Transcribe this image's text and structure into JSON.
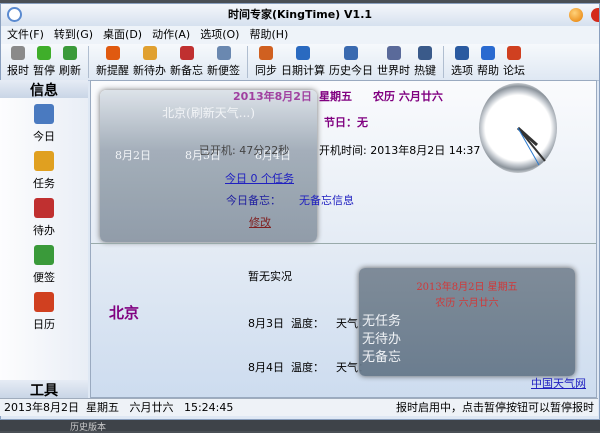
{
  "window": {
    "title": "时间专家(KingTime) V1.1"
  },
  "menu": [
    "文件(F)",
    "转到(G)",
    "桌面(D)",
    "动作(A)",
    "选项(O)",
    "帮助(H)"
  ],
  "toolbar": [
    {
      "label": "报时",
      "icon": "speaker-icon",
      "color": "#8a8a8a"
    },
    {
      "label": "暂停",
      "icon": "pause-icon",
      "color": "#3fae2a"
    },
    {
      "label": "刷新",
      "icon": "refresh-icon",
      "color": "#3a9a3a"
    },
    {
      "label": "新提醒",
      "icon": "alarm-clock-icon",
      "color": "#e05a10"
    },
    {
      "label": "新待办",
      "icon": "todo-icon",
      "color": "#e0a030"
    },
    {
      "label": "新备忘",
      "icon": "memo-grid-icon",
      "color": "#c03030"
    },
    {
      "label": "新便签",
      "icon": "note-icon",
      "color": "#6a88b0"
    },
    {
      "label": "同步",
      "icon": "sync-icon",
      "color": "#d06020"
    },
    {
      "label": "日期计算",
      "icon": "calculator-icon",
      "color": "#2a6ac0"
    },
    {
      "label": "历史今日",
      "icon": "history-icon",
      "color": "#3a6ab0"
    },
    {
      "label": "世界时",
      "icon": "globe-icon",
      "color": "#5a6a9a"
    },
    {
      "label": "热键",
      "icon": "joystick-icon",
      "color": "#3a5a8a"
    },
    {
      "label": "选项",
      "icon": "options-icon",
      "color": "#2a5aa0"
    },
    {
      "label": "帮助",
      "icon": "help-icon",
      "color": "#2a6ad0"
    },
    {
      "label": "论坛",
      "icon": "forum-icon",
      "color": "#d04020"
    }
  ],
  "sidebar": {
    "header": "信息",
    "items": [
      {
        "label": "今日",
        "icon": "today-icon",
        "color": "#4a7ac0"
      },
      {
        "label": "任务",
        "icon": "task-icon",
        "color": "#e0a020"
      },
      {
        "label": "待办",
        "icon": "todo-icon",
        "color": "#c03030"
      },
      {
        "label": "便签",
        "icon": "note-icon",
        "color": "#3a9a3a"
      },
      {
        "label": "日历",
        "icon": "calendar-icon",
        "color": "#d04020"
      }
    ],
    "footer": "工具"
  },
  "today": {
    "date": "2013年8月2日",
    "weekday": "星期五",
    "lunar": "农历 六月廿六",
    "festival": "节日：无",
    "uptime": "已开机: 47分22秒",
    "boot_time": "开机时间: 2013年8月2日 14:37",
    "tasks_link": "今日 0 个任务",
    "memo_label": "今日备忘：",
    "memo_value": "无备忘信息",
    "edit_link": "修改"
  },
  "weather_overlay": {
    "city": "北京(刷新天气...)",
    "days": [
      "8月2日",
      "8月3日",
      "8月4日"
    ]
  },
  "weather": {
    "city": "北京",
    "current": "暂无实况",
    "rows": [
      {
        "date": "8月3日",
        "temp": "温度：",
        "weather": "天气："
      },
      {
        "date": "8月4日",
        "temp": "温度：",
        "weather": "天气："
      }
    ],
    "source_link": "中国天气网"
  },
  "summary_overlay": {
    "date": "2013年8月2日 星期五",
    "lunar": "农历 六月廿六",
    "lines": [
      "无任务",
      "无待办",
      "无备忘"
    ]
  },
  "status": {
    "left": "2013年8月2日  星期五   六月廿六   15:24:45",
    "right": "报时启用中，点击暂停按钮可以暂停报时"
  },
  "desktop": {
    "text": "历史版本"
  }
}
